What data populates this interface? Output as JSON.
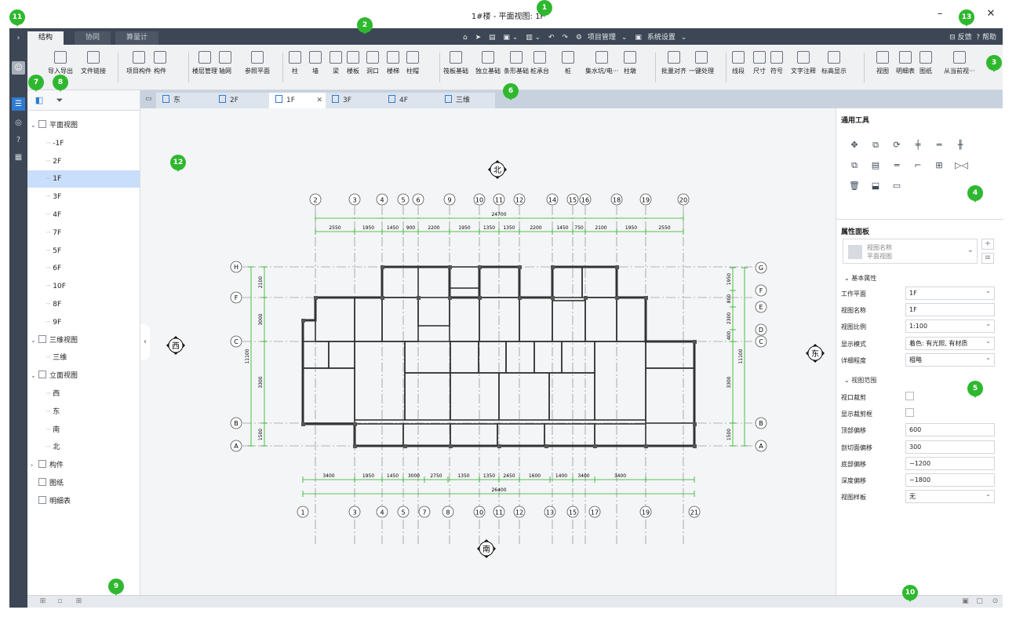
{
  "window": {
    "title": "1#楼 - 平面视图: 1F",
    "minimize": "–",
    "close": "✕"
  },
  "top_tabs": [
    "结构",
    "协同",
    "算量计"
  ],
  "quick_access": {
    "project_manage": "项目管理",
    "system_settings": "系统设置"
  },
  "header_right": {
    "feedback": "反馈",
    "help": "帮助"
  },
  "ribbon": {
    "groups": [
      [
        "导入导出",
        "文件链接"
      ],
      [
        "项目构件",
        "构件"
      ],
      [
        "楼层管理",
        "轴网",
        "参照平面"
      ],
      [
        "柱",
        "墙",
        "梁",
        "楼板",
        "洞口",
        "楼梯",
        "柱帽"
      ],
      [
        "筏板基础",
        "独立基础",
        "条形基础",
        "桩承台",
        "桩",
        "集水坑/电···",
        "柱墩"
      ],
      [
        "批量对齐",
        "一键处理"
      ],
      [
        "线段",
        "尺寸",
        "符号",
        "文字注释",
        "标高显示"
      ],
      [
        "视图",
        "明细表",
        "图纸",
        "从当前视···"
      ]
    ]
  },
  "tree": {
    "items": [
      {
        "label": "平面视图",
        "level": 0,
        "expanded": true
      },
      {
        "label": "-1F",
        "level": 1
      },
      {
        "label": "2F",
        "level": 1
      },
      {
        "label": "1F",
        "level": 1,
        "selected": true
      },
      {
        "label": "3F",
        "level": 1
      },
      {
        "label": "4F",
        "level": 1
      },
      {
        "label": "7F",
        "level": 1
      },
      {
        "label": "5F",
        "level": 1
      },
      {
        "label": "6F",
        "level": 1
      },
      {
        "label": "10F",
        "level": 1
      },
      {
        "label": "8F",
        "level": 1
      },
      {
        "label": "9F",
        "level": 1
      },
      {
        "label": "三维视图",
        "level": 0,
        "expanded": true
      },
      {
        "label": "三维",
        "level": 1
      },
      {
        "label": "立面视图",
        "level": 0,
        "expanded": true
      },
      {
        "label": "西",
        "level": 1
      },
      {
        "label": "东",
        "level": 1
      },
      {
        "label": "南",
        "level": 1
      },
      {
        "label": "北",
        "level": 1
      },
      {
        "label": "构件",
        "level": 0,
        "expanded": false
      },
      {
        "label": "图纸",
        "level": 0
      },
      {
        "label": "明细表",
        "level": 0
      }
    ]
  },
  "doc_tabs": [
    "东",
    "2F",
    "1F",
    "3F",
    "4F",
    "三维"
  ],
  "active_doc_tab": "1F",
  "drawing": {
    "compass": {
      "north": "北",
      "south": "南",
      "west": "西",
      "east": "东"
    },
    "top_axes": [
      "2",
      "3",
      "4",
      "5",
      "6",
      "9",
      "10",
      "11",
      "12",
      "14",
      "15",
      "16",
      "18",
      "19",
      "20"
    ],
    "bottom_axes": [
      "1",
      "3",
      "4",
      "5",
      "7",
      "8",
      "10",
      "11",
      "12",
      "13",
      "15",
      "17",
      "19",
      "21"
    ],
    "left_axes": [
      "H",
      "F",
      "C",
      "B",
      "A"
    ],
    "right_axes": [
      "G",
      "F",
      "E",
      "D",
      "C",
      "B",
      "A"
    ],
    "top_total": "24700",
    "top_dims": [
      "2550",
      "1950",
      "1450",
      "900",
      "2200",
      "1950",
      "1350",
      "1350",
      "2200",
      "1450",
      "750",
      "2100",
      "1950",
      "2550"
    ],
    "bottom_total": "26400",
    "bottom_dims": [
      "3400",
      "1950",
      "1450",
      "3000",
      "2750",
      "1350",
      "1350",
      "2450",
      "1600",
      "1400",
      "3400",
      "3400"
    ],
    "left_total": "11100",
    "left_dims": [
      "2100",
      "3000",
      "3300",
      "1500"
    ],
    "right_total": "11100",
    "right_dims": [
      "1950",
      "800",
      "2300",
      "400",
      "3300",
      "1500"
    ]
  },
  "right_panel": {
    "tools_title": "通用工具",
    "tools": [
      "move-icon",
      "copy-icon",
      "rotate-icon",
      "align-icon",
      "split-icon",
      "trim-icon",
      "array-icon",
      "offset-icon",
      "extend-icon",
      "scale-icon",
      "group-icon",
      "mirror-icon",
      "delete-icon",
      "paint-icon",
      "measure-icon"
    ],
    "props_title": "属性面板",
    "type_name": "视图名称",
    "type_sub": "平面视图",
    "group_basic": "基本属性",
    "group_range": "视图范围",
    "props": [
      {
        "label": "工作平面",
        "value": "1F",
        "type": "select"
      },
      {
        "label": "视图名称",
        "value": "1F",
        "type": "text"
      },
      {
        "label": "视图比例",
        "value": "1:100",
        "type": "select"
      },
      {
        "label": "显示模式",
        "value": "着色: 有光照, 有材质",
        "type": "select"
      },
      {
        "label": "详细程度",
        "value": "粗略",
        "type": "select"
      }
    ],
    "range_props": [
      {
        "label": "视口裁剪",
        "type": "check"
      },
      {
        "label": "显示裁剪框",
        "type": "check"
      },
      {
        "label": "顶部偏移",
        "value": "600",
        "type": "text"
      },
      {
        "label": "剖切面偏移",
        "value": "300",
        "type": "text"
      },
      {
        "label": "底部偏移",
        "value": "−1200",
        "type": "text"
      },
      {
        "label": "深度偏移",
        "value": "−1800",
        "type": "text"
      },
      {
        "label": "视图样板",
        "value": "无",
        "type": "select"
      }
    ]
  },
  "markers": [
    "1",
    "2",
    "3",
    "4",
    "5",
    "6",
    "7",
    "8",
    "9",
    "10",
    "11",
    "12",
    "13"
  ],
  "colors": {
    "rail": "#3d4654",
    "accent": "#2f7bd1",
    "marker": "#2fb82f",
    "dim": "#22b322"
  }
}
